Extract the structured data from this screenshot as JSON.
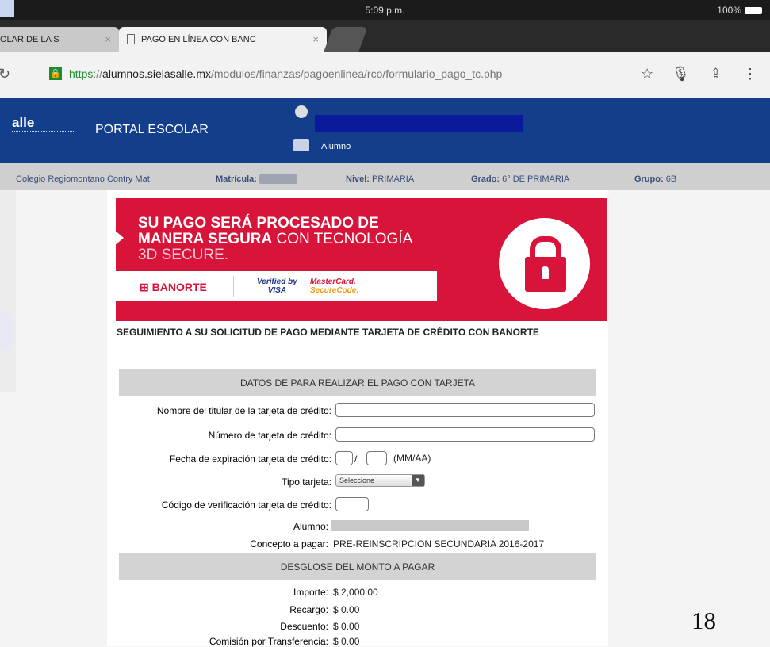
{
  "status_bar": {
    "time": "5:09 p.m.",
    "battery": "100%"
  },
  "tabs": [
    {
      "label": "OLAR DE LA S",
      "close": "×"
    },
    {
      "label": "PAGO EN LÍNEA CON BANC",
      "close": "×"
    }
  ],
  "address_bar": {
    "scheme": "https",
    "separator": "://",
    "domain": "alumnos.sielasalle.mx",
    "path": "/modulos/finanzas/pagoenlinea/rco/formulario_pago_tc.php"
  },
  "portal": {
    "logo": "alle",
    "title": "PORTAL ESCOLAR",
    "role": "Alumno"
  },
  "info_bar": {
    "school": "Colegio Regiomontano Contry Mat",
    "matricula_label": "Matrícula:",
    "nivel_label": "Nivel:",
    "nivel_value": "PRIMARIA",
    "grado_label": "Grado:",
    "grado_value": "6° DE PRIMARIA",
    "grupo_label": "Grupo:",
    "grupo_value": "6B"
  },
  "banner": {
    "line1": "SU PAGO SERÁ PROCESADO DE",
    "line2_bold": "MANERA SEGURA",
    "line2_rest": " CON TECNOLOGÍA",
    "line3": "3D SECURE.",
    "banorte": "BANORTE",
    "visa_top": "Verified by",
    "visa_bottom": "VISA",
    "mc_top": "MasterCard.",
    "mc_bottom": "SecureCode."
  },
  "heading": "SEGUIMIENTO A SU SOLICITUD DE PAGO MEDIANTE TARJETA DE CRÉDITO CON BANORTE",
  "form": {
    "section_title": "DATOS DE PARA REALIZAR EL PAGO CON TARJETA",
    "holder_label": "Nombre del titular de la tarjeta de crédito:",
    "number_label": "Número de tarjeta de crédito:",
    "expiry_label": "Fecha de expiración tarjeta de crédito:",
    "expiry_sep": "/",
    "expiry_hint": "(MM/AA)",
    "type_label": "Tipo tarjeta:",
    "type_selected": "Seleccione",
    "cvv_label": "Código de verificación tarjeta de crédito:",
    "student_label": "Alumno:",
    "concept_label": "Concepto a pagar:",
    "concept_value": "PRE-REINSCRIPCION SECUNDARIA 2016-2017"
  },
  "breakdown": {
    "section_title": "DESGLOSE DEL MONTO A PAGAR",
    "rows": [
      {
        "label": "Importe:",
        "value": "$ 2,000.00"
      },
      {
        "label": "Recargo:",
        "value": "$ 0.00"
      },
      {
        "label": "Descuento:",
        "value": "$ 0.00"
      },
      {
        "label": "Comisión por Transferencia:",
        "value": "$ 0.00"
      }
    ]
  },
  "slide_number": "18"
}
